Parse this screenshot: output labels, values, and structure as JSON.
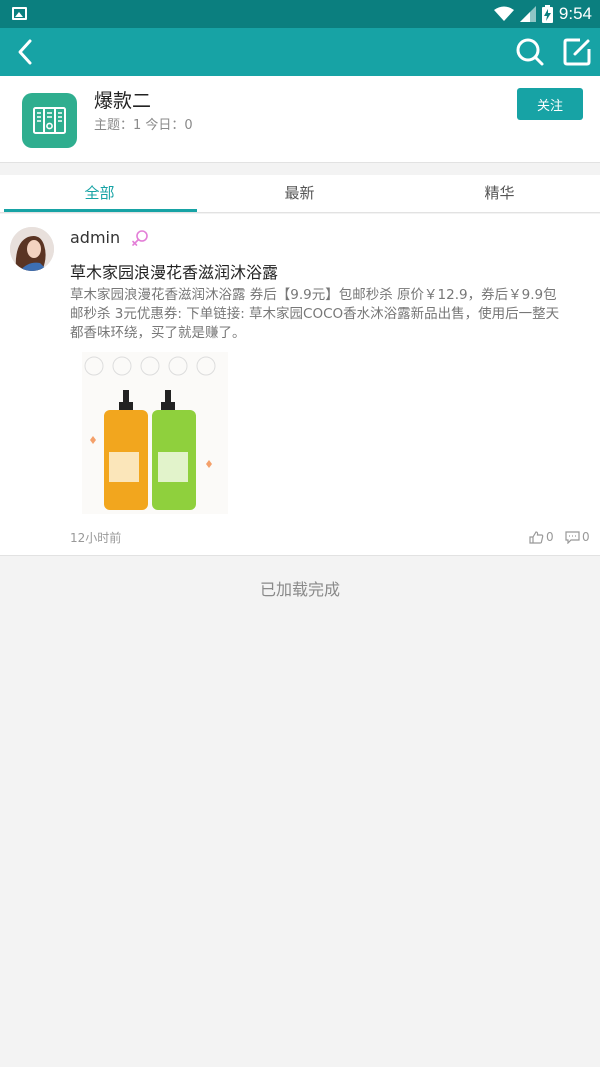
{
  "status_bar": {
    "time": "9:54"
  },
  "forum": {
    "title": "爆款二",
    "stats": "主题：1  今日：0",
    "follow_label": "关注",
    "icon": "book-forum-icon",
    "icon_color": "#2fae8f"
  },
  "colors": {
    "accent": "#17a3a5",
    "status_bar": "#0b7f7f"
  },
  "tabs": [
    {
      "label": "全部",
      "active": true
    },
    {
      "label": "最新",
      "active": false
    },
    {
      "label": "精华",
      "active": false
    }
  ],
  "post": {
    "username": "admin",
    "title": "草木家园浪漫花香滋润沐浴露",
    "excerpt": "草木家园浪漫花香滋润沐浴露 券后【9.9元】包邮秒杀 原价￥12.9，券后￥9.9包邮秒杀 3元优惠券: 下单链接: 草木家园COCO香水沐浴露新品出售，使用后一整天都香味环绕，买了就是赚了。",
    "time": "12小时前",
    "likes": "0",
    "comments": "0"
  },
  "list_end_text": "已加载完成"
}
